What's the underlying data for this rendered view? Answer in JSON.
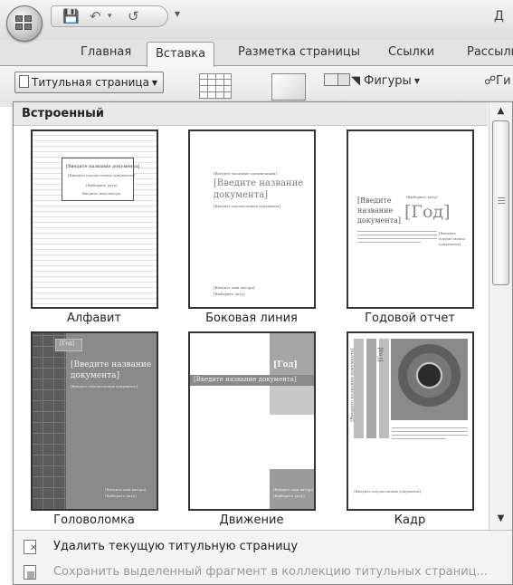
{
  "window": {
    "title_fragment": "Д"
  },
  "tabs": [
    "Главная",
    "Вставка",
    "Разметка страницы",
    "Ссылки",
    "Рассылки"
  ],
  "ribbon": {
    "cover_page_label": "Титульная страница",
    "shapes_label": "Фигуры",
    "link_label_fragment": "Ги"
  },
  "gallery": {
    "section_title": "Встроенный",
    "items": [
      {
        "name": "Алфавит",
        "texts": [
          "[Введите название документа]",
          "[Введите подзаголовок документа]",
          "[Выберите дату]",
          "Введите имя автора"
        ]
      },
      {
        "name": "Боковая линия",
        "texts": [
          "[Введите название организации]",
          "[Введите название",
          "документа]",
          "[Введите подзаголовок документа]",
          "[Введите имя автора]",
          "[Выберите дату]"
        ]
      },
      {
        "name": "Годовой отчет",
        "texts": [
          "[Введите",
          "название",
          "документа]",
          "[Выберите дату]",
          "[Год]",
          "[Введите",
          "подзаголовок",
          "документа]"
        ]
      },
      {
        "name": "Головоломка",
        "texts": [
          "[Год]",
          "[Введите название",
          "документа]",
          "[Введите подзаголовок документа]",
          "[Введите имя автора]",
          "[Выберите дату]"
        ]
      },
      {
        "name": "Движение",
        "texts": [
          "[Год]",
          "[Введите название документа]",
          "[Введите имя автора]",
          "[Выберите дату]"
        ]
      },
      {
        "name": "Кадр",
        "texts": [
          "[Введите название документа]",
          "[Год]",
          "[Введите подзаголовок документа]"
        ]
      }
    ]
  },
  "menu": {
    "remove_label": "Удалить текущую титульную страницу",
    "save_label": "Сохранить выделенный фрагмент в коллекцию титульных страниц..."
  }
}
